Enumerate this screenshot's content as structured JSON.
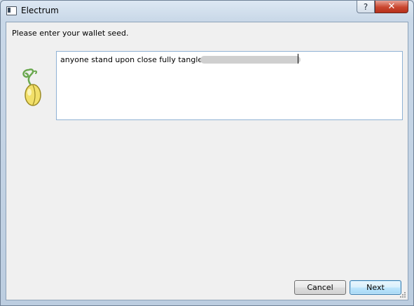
{
  "window": {
    "title": "Electrum",
    "help_label": "?",
    "close_label": "✕"
  },
  "dialog": {
    "prompt": "Please enter your wallet seed.",
    "seed_value": "anyone stand upon close fully tangle mine",
    "logo_icon": "electrum-seed-icon"
  },
  "buttons": {
    "cancel_label": "Cancel",
    "next_label": "Next"
  },
  "colors": {
    "titlebar": "#c9d8e8",
    "client_bg": "#f0f0f0",
    "seed_border": "#8fb1d4",
    "next_border": "#3c7fb1",
    "close_red": "#c9462f"
  }
}
